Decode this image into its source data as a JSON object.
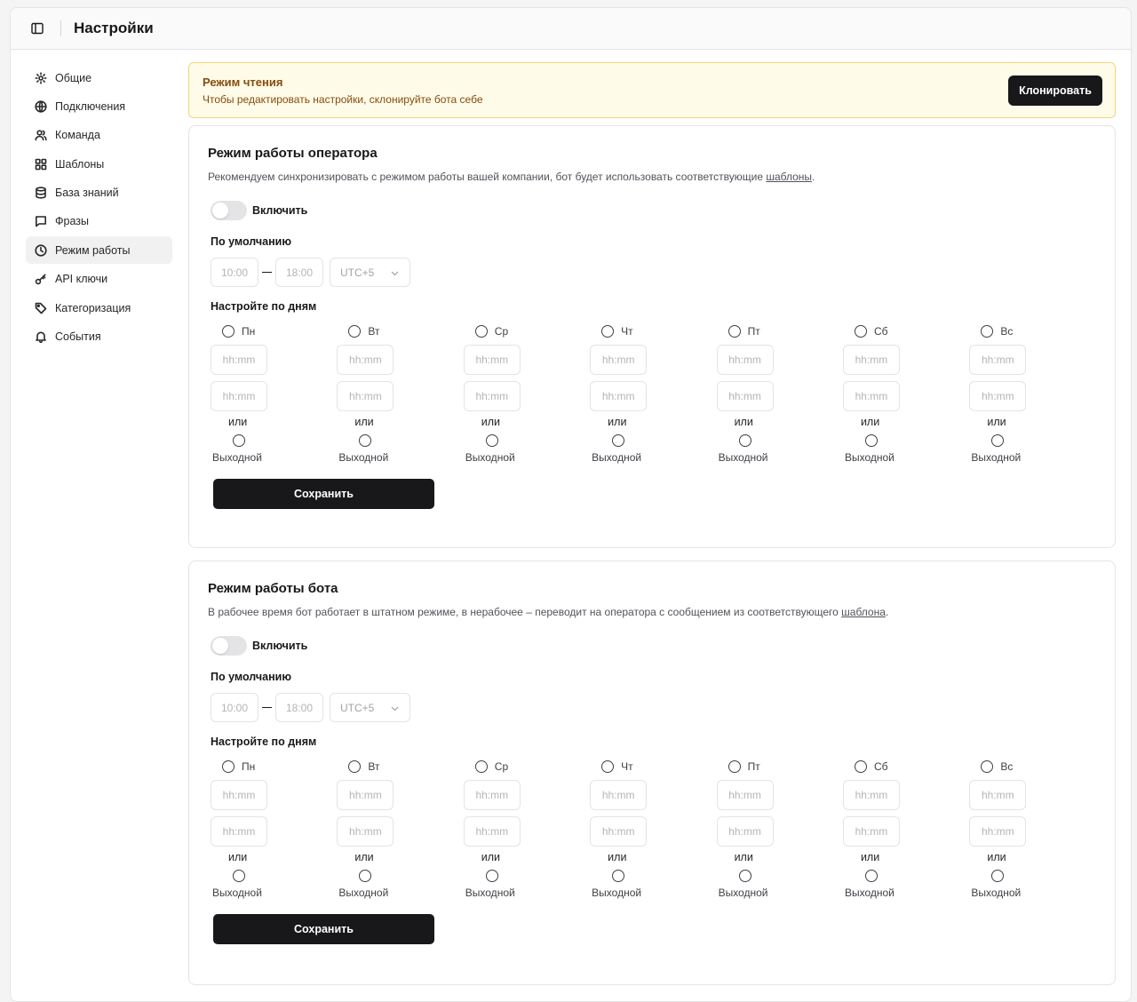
{
  "header": {
    "title": "Настройки"
  },
  "sidebar": {
    "items": [
      {
        "label": "Общие",
        "icon": "gear-icon"
      },
      {
        "label": "Подключения",
        "icon": "globe-icon"
      },
      {
        "label": "Команда",
        "icon": "users-icon"
      },
      {
        "label": "Шаблоны",
        "icon": "grid-icon"
      },
      {
        "label": "База знаний",
        "icon": "database-icon"
      },
      {
        "label": "Фразы",
        "icon": "message-icon"
      },
      {
        "label": "Режим работы",
        "icon": "clock-icon",
        "active": true
      },
      {
        "label": "API ключи",
        "icon": "key-icon"
      },
      {
        "label": "Категоризация",
        "icon": "tag-icon"
      },
      {
        "label": "События",
        "icon": "bell-icon"
      }
    ]
  },
  "banner": {
    "title": "Режим чтения",
    "text": "Чтобы редактировать настройки, склонируйте бота себе",
    "button": "Клонировать"
  },
  "operator": {
    "title": "Режим работы оператора",
    "desc": "Рекомендуем синхронизировать с режимом работы вашей компании, бот будет использовать соответствующие ",
    "desc_link": "шаблоны",
    "desc_end": ".",
    "enable_label": "Включить",
    "default_label": "По умолчанию",
    "default_start": "10:00",
    "default_end": "18:00",
    "timezone": "UTC+5",
    "days_label": "Настройте по дням",
    "save": "Сохранить"
  },
  "bot": {
    "title": "Режим работы бота",
    "desc": "В рабочее время бот работает в штатном режиме, в нерабочее – переводит на оператора с сообщением из соответствующего ",
    "desc_link": "шаблона",
    "desc_end": ".",
    "enable_label": "Включить",
    "default_label": "По умолчанию",
    "default_start": "10:00",
    "default_end": "18:00",
    "timezone": "UTC+5",
    "days_label": "Настройте по дням",
    "save": "Сохранить"
  },
  "days": [
    "Пн",
    "Вт",
    "Ср",
    "Чт",
    "Пт",
    "Сб",
    "Вс"
  ],
  "time_placeholder": "hh:mm",
  "or_label": "или",
  "weekend_label": "Выходной"
}
